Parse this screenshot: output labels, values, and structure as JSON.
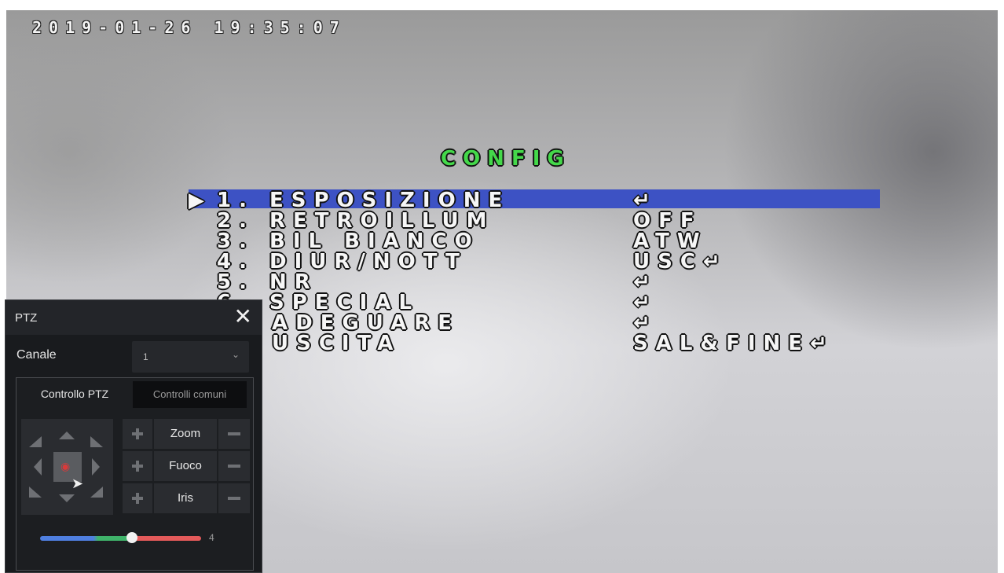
{
  "osd": {
    "timestamp": "2019-01-26 19:35:07",
    "title": "CONFIG",
    "selected_marker": "▶",
    "highlight_color": "#3d52c4",
    "title_color": "#44d84a",
    "items": [
      {
        "label": "1. ESPOSIZIONE",
        "value": "↵"
      },
      {
        "label": "2. RETROILLUM",
        "value": "OFF"
      },
      {
        "label": "3. BIL BIANCO",
        "value": "ATW"
      },
      {
        "label": "4. DIUR/NOTT",
        "value": "USC↵"
      },
      {
        "label": "5. NR",
        "value": "↵"
      },
      {
        "label": "6. SPECIAL",
        "value": "↵"
      },
      {
        "label": "ADEGUARE",
        "value": "↵"
      },
      {
        "label": "USCITA",
        "value": "SAL&FINE↵"
      }
    ]
  },
  "ptz": {
    "title": "PTZ",
    "close_icon": "close-icon",
    "channel_label": "Canale",
    "channel_value": "1",
    "tabs": [
      {
        "label": "Controllo PTZ",
        "active": true
      },
      {
        "label": "Controlli comuni",
        "active": false
      }
    ],
    "controls": [
      {
        "label": "Zoom"
      },
      {
        "label": "Fuoco"
      },
      {
        "label": "Iris"
      }
    ],
    "speed_value": "4",
    "speed_fraction": 0.57
  }
}
